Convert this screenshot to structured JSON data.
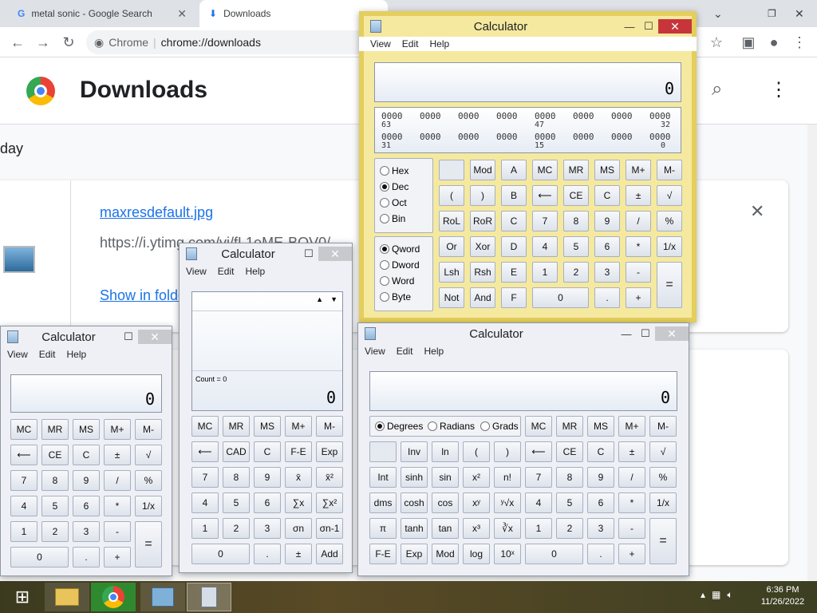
{
  "browser": {
    "tabs": [
      {
        "label": "metal sonic - Google Search",
        "close": "✕"
      },
      {
        "label": "Downloads",
        "close": "✕"
      }
    ],
    "new_tab": "+",
    "omnibox": {
      "site": "Chrome",
      "url": "chrome://downloads"
    },
    "page_title": "Downloads",
    "section": "day",
    "item": {
      "file": "maxresdefault.jpg",
      "url": "https://i.ytimg.com/vi/fL1eME-BOV0/",
      "action": "Show in folder",
      "close": "✕"
    }
  },
  "calc_programmer": {
    "title": "Calculator",
    "menu": [
      "View",
      "Edit",
      "Help"
    ],
    "display": "0",
    "bits": {
      "row1": [
        "0000",
        "0000",
        "0000",
        "0000",
        "0000",
        "0000",
        "0000",
        "0000"
      ],
      "row1_labels": [
        "63",
        "47",
        "32"
      ],
      "row2": [
        "0000",
        "0000",
        "0000",
        "0000",
        "0000",
        "0000",
        "0000",
        "0000"
      ],
      "row2_labels": [
        "31",
        "15",
        "0"
      ]
    },
    "base": [
      "Hex",
      "Dec",
      "Oct",
      "Bin"
    ],
    "base_selected": "Dec",
    "size": [
      "Qword",
      "Dword",
      "Word",
      "Byte"
    ],
    "size_selected": "Qword",
    "rows": [
      [
        "",
        "Mod",
        "A",
        "MC",
        "MR",
        "MS",
        "M+",
        "M-"
      ],
      [
        "(",
        ")",
        "B",
        "⟵",
        "CE",
        "C",
        "±",
        "√"
      ],
      [
        "RoL",
        "RoR",
        "C",
        "7",
        "8",
        "9",
        "/",
        "%"
      ],
      [
        "Or",
        "Xor",
        "D",
        "4",
        "5",
        "6",
        "*",
        "1/x"
      ],
      [
        "Lsh",
        "Rsh",
        "E",
        "1",
        "2",
        "3",
        "-",
        "="
      ],
      [
        "Not",
        "And",
        "F",
        "0",
        ".",
        "+"
      ]
    ]
  },
  "calc_standard": {
    "title": "Calculator",
    "menu": [
      "View",
      "Edit",
      "Help"
    ],
    "display": "0",
    "rows": [
      [
        "MC",
        "MR",
        "MS",
        "M+",
        "M-"
      ],
      [
        "⟵",
        "CE",
        "C",
        "±",
        "√"
      ],
      [
        "7",
        "8",
        "9",
        "/",
        "%"
      ],
      [
        "4",
        "5",
        "6",
        "*",
        "1/x"
      ],
      [
        "1",
        "2",
        "3",
        "-",
        "="
      ],
      [
        "0",
        ".",
        "+"
      ]
    ]
  },
  "calc_statistics": {
    "title": "Calculator",
    "menu": [
      "View",
      "Edit",
      "Help"
    ],
    "count": "Count = 0",
    "display": "0",
    "rows": [
      [
        "MC",
        "MR",
        "MS",
        "M+",
        "M-"
      ],
      [
        "⟵",
        "CAD",
        "C",
        "F-E",
        "Exp"
      ],
      [
        "7",
        "8",
        "9",
        "x̄",
        "x̄²"
      ],
      [
        "4",
        "5",
        "6",
        "∑x",
        "∑x²"
      ],
      [
        "1",
        "2",
        "3",
        "σn",
        "σn-1"
      ],
      [
        "0",
        ".",
        "±",
        "Add"
      ]
    ]
  },
  "calc_scientific": {
    "title": "Calculator",
    "menu": [
      "View",
      "Edit",
      "Help"
    ],
    "display": "0",
    "angle": [
      "Degrees",
      "Radians",
      "Grads"
    ],
    "angle_selected": "Degrees",
    "rows": [
      [
        "MC",
        "MR",
        "MS",
        "M+",
        "M-"
      ],
      [
        "",
        "Inv",
        "ln",
        "(",
        ")",
        "⟵",
        "CE",
        "C",
        "±",
        "√"
      ],
      [
        "Int",
        "sinh",
        "sin",
        "x²",
        "n!",
        "7",
        "8",
        "9",
        "/",
        "%"
      ],
      [
        "dms",
        "cosh",
        "cos",
        "xʸ",
        "ʸ√x",
        "4",
        "5",
        "6",
        "*",
        "1/x"
      ],
      [
        "π",
        "tanh",
        "tan",
        "x³",
        "∛x",
        "1",
        "2",
        "3",
        "-",
        "="
      ],
      [
        "F-E",
        "Exp",
        "Mod",
        "log",
        "10ˣ",
        "0",
        ".",
        "+"
      ]
    ]
  },
  "taskbar": {
    "time": "6:36 PM",
    "date": "11/26/2022"
  }
}
